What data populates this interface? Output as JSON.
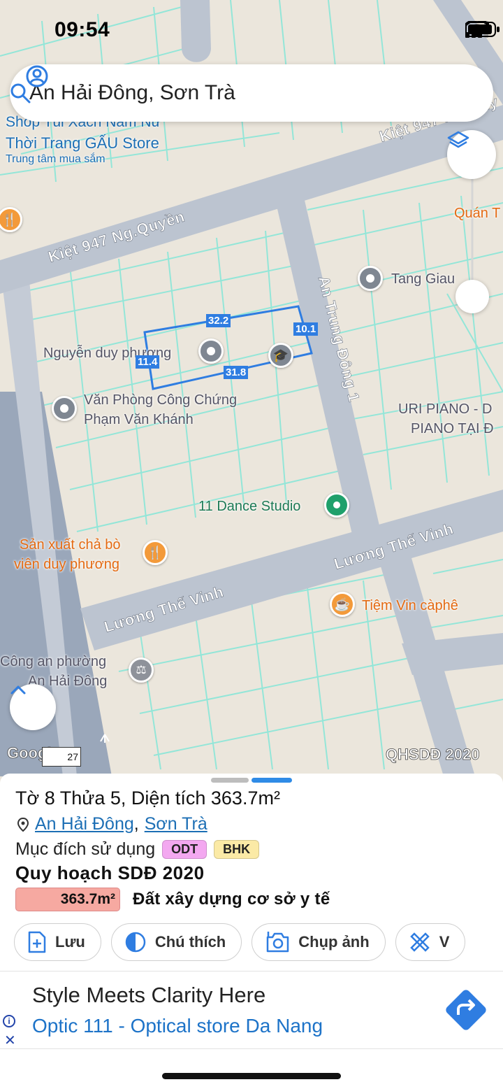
{
  "status_bar": {
    "time": "09:54"
  },
  "search": {
    "text": "An Hải Đông, Sơn Trà"
  },
  "map": {
    "roads": {
      "kiet_top_right": "Kiệt 947 Ng.Quy",
      "kiet_left": "Kiệt 947 Ng.Quyền",
      "an_trung_dong": "An Trung Đông 1",
      "luong_the_vinh_right": "Lương Thế Vinh",
      "luong_the_vinh_left": "Lương Thế Vinh"
    },
    "pois": {
      "shop_line1": "Shop Túi Xách Nam Nữ",
      "shop_line2": "Thời Trang GẤU Store",
      "shop_sub": "Trung tâm mua sắm",
      "quan": "Quán T",
      "tang_giau": "Tang Giau",
      "nguyen_duy_phuong": "Nguyễn duy phương",
      "van_phong_line1": "Văn Phòng Công Chứng",
      "van_phong_line2": "Phạm Văn Khánh",
      "uri_line1": "URI PIANO - D",
      "uri_line2": "PIANO TẠI Đ",
      "dance": "11 Dance Studio",
      "san_xuat_line1": "Sản xuất chả bò",
      "san_xuat_line2": "viên duy phương",
      "tiem_vin": "Tiệm Vin càphê",
      "cong_an_line1": "Công an phường",
      "cong_an_line2": "An Hải Đông"
    },
    "dimensions": {
      "top": "32.2",
      "right": "10.1",
      "bottom": "31.8",
      "left": "11.4"
    },
    "attribution": {
      "google": "Google",
      "google_extra": "27",
      "layer": "QHSDĐ 2020"
    }
  },
  "sheet": {
    "title": "Tờ 8 Thửa 5, Diện tích 363.7m²",
    "location": {
      "ward": "An Hải Đông",
      "separator": ",",
      "district": "Sơn Trà"
    },
    "purpose_label": "Mục đích sử dụng",
    "tags": [
      {
        "label": "ODT",
        "color": "#f3a8f0"
      },
      {
        "label": "BHK",
        "color": "#fbeaa6"
      }
    ],
    "plan_title": "Quy hoạch SDĐ 2020",
    "landuse": {
      "area": "363.7m²",
      "area_color": "#f6a9a1",
      "description": "Đất xây dựng cơ sở y tế"
    },
    "actions": [
      {
        "label": "Lưu",
        "icon": "add-file-icon"
      },
      {
        "label": "Chú thích",
        "icon": "half-circle-icon"
      },
      {
        "label": "Chụp ảnh",
        "icon": "camera-icon"
      },
      {
        "label": "V",
        "icon": "ruler-pencil-icon"
      }
    ]
  },
  "ad": {
    "title": "Style Meets Clarity Here",
    "subtitle": "Optic 111 - Optical store Da Nang",
    "info": "i",
    "close": "✕"
  },
  "colors": {
    "accent": "#2f7de1",
    "link": "#1d6fb5",
    "road": "#b7bfcc",
    "parcel_line": "#7fe3d3"
  }
}
